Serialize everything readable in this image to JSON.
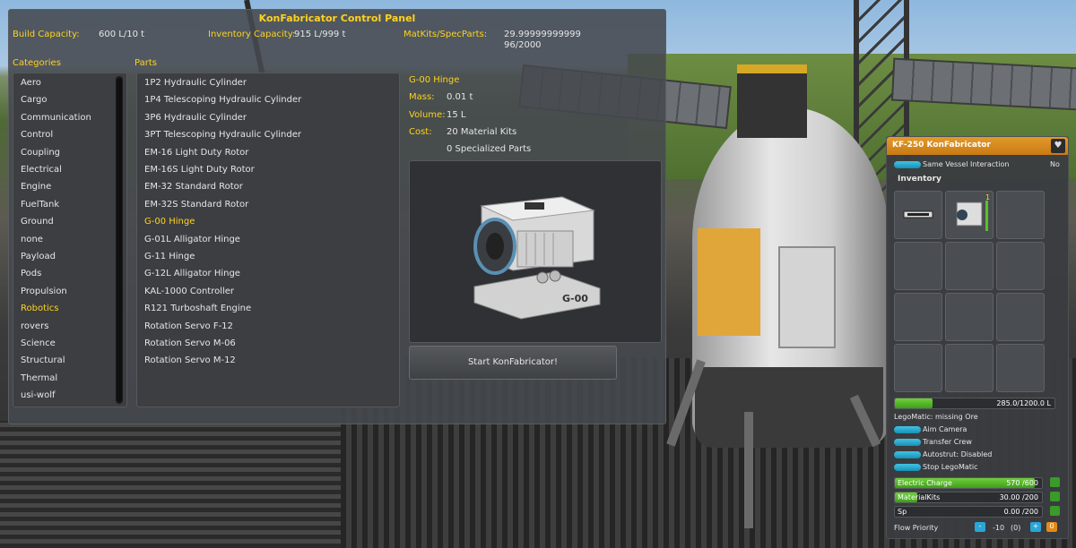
{
  "control_panel": {
    "title": "KonFabricator Control Panel",
    "build_capacity_label": "Build Capacity:",
    "build_capacity_value": "600 L/10 t",
    "inventory_capacity_label": "Inventory Capacity:",
    "inventory_capacity_value": "915 L/999 t",
    "matkits_label": "MatKits/SpecParts:",
    "matkits_value": "29.99999999999",
    "specparts_value": "96/2000",
    "categories_header": "Categories",
    "parts_header": "Parts",
    "categories": [
      "Aero",
      "Cargo",
      "Communication",
      "Control",
      "Coupling",
      "Electrical",
      "Engine",
      "FuelTank",
      "Ground",
      "none",
      "Payload",
      "Pods",
      "Propulsion",
      "Robotics",
      "rovers",
      "Science",
      "Structural",
      "Thermal",
      "usi-wolf"
    ],
    "selected_category": "Robotics",
    "parts": [
      "1P2 Hydraulic Cylinder",
      "1P4 Telescoping Hydraulic Cylinder",
      "3P6 Hydraulic Cylinder",
      "3PT Telescoping Hydraulic Cylinder",
      "EM-16 Light Duty Rotor",
      "EM-16S Light Duty Rotor",
      "EM-32 Standard Rotor",
      "EM-32S Standard Rotor",
      "G-00 Hinge",
      "G-01L Alligator Hinge",
      "G-11 Hinge",
      "G-12L Alligator Hinge",
      "KAL-1000 Controller",
      "R121 Turboshaft Engine",
      "Rotation Servo F-12",
      "Rotation Servo M-06",
      "Rotation Servo M-12"
    ],
    "selected_part": "G-00 Hinge",
    "detail": {
      "name": "G-00 Hinge",
      "mass_label": "Mass:",
      "mass_value": "0.01 t",
      "volume_label": "Volume:",
      "volume_value": "15 L",
      "cost_label": "Cost:",
      "cost_value": "20 Material Kits",
      "cost_value2": "0 Specialized Parts",
      "model_label": "G-00"
    },
    "start_button": "Start KonFabricator!"
  },
  "inventory_window": {
    "title": "KF-250 KonFabricator",
    "same_vessel_label": "Same Vessel Interaction",
    "same_vessel_value": "No",
    "inventory_header": "Inventory",
    "slot_count_badge": "1",
    "volume_bar_text": "285.0/1200.0 L",
    "volume_fill": 0.2375,
    "legomatic_status": "LegoMatic: missing Ore",
    "buttons": [
      "Aim Camera",
      "Transfer Crew",
      "Autostrut: Disabled",
      "Stop LegoMatic"
    ],
    "resources": [
      {
        "name": "Electric Charge",
        "text": "570 /600",
        "fill": 0.95
      },
      {
        "name": "MaterialKits",
        "text": "30.00 /200",
        "fill": 0.15
      },
      {
        "name": "Sp",
        "text": "0.00 /200",
        "fill": 0.0
      }
    ],
    "flow_priority_label": "Flow Priority",
    "flow_minus": "-",
    "flow_value": "-10",
    "flow_paren": "(0)",
    "flow_plus": "+",
    "flow_badge": "0"
  },
  "colors": {
    "accent_yellow": "#ffd21e",
    "orange_header": "#e29a2a",
    "bar_green": "#5cbf2a",
    "toggle_blue": "#2fb0d6"
  }
}
